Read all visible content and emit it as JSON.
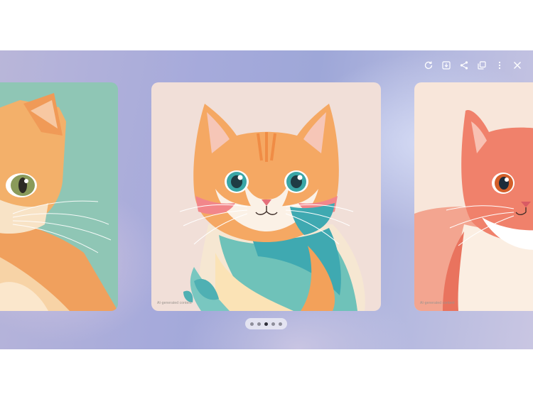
{
  "toolbar": {
    "buttons": [
      {
        "name": "refresh-button",
        "icon": "refresh-icon"
      },
      {
        "name": "download-button",
        "icon": "download-icon"
      },
      {
        "name": "share-button",
        "icon": "share-icon"
      },
      {
        "name": "copy-button",
        "icon": "copy-icon"
      },
      {
        "name": "more-options-button",
        "icon": "more-vertical-icon"
      },
      {
        "name": "close-button",
        "icon": "close-icon"
      }
    ]
  },
  "carousel": {
    "images": [
      {
        "label": "cat-illustration-left",
        "watermark": ""
      },
      {
        "label": "cat-illustration-center",
        "watermark": "AI-generated content"
      },
      {
        "label": "cat-illustration-right",
        "watermark": "AI-generated content"
      }
    ],
    "pager": {
      "total": 5,
      "current": 3
    }
  },
  "colors": {
    "center_bg": "#f1dfd8",
    "left_bg": "#8fc6b5",
    "right_bg": "#f8e6da",
    "accent_orange": "#f3a15a",
    "accent_teal": "#3fa9b1"
  }
}
